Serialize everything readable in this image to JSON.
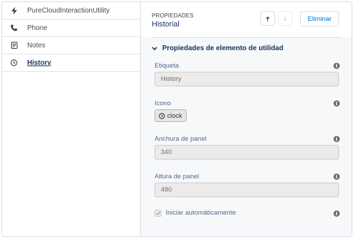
{
  "sidebar": {
    "items": [
      {
        "label": "PureCloudInteractionUtility",
        "icon": "lightning-icon"
      },
      {
        "label": "Phone",
        "icon": "phone-icon"
      },
      {
        "label": "Notes",
        "icon": "note-icon"
      },
      {
        "label": "History",
        "icon": "clock-icon",
        "active": true
      }
    ]
  },
  "header": {
    "eyebrow": "PROPIEDADES",
    "title": "Historial",
    "delete_label": "Eliminar"
  },
  "section": {
    "title": "Propiedades de elemento de utilidad"
  },
  "fields": {
    "label": {
      "label": "Etiqueta",
      "value": "History"
    },
    "icon": {
      "label": "Icono",
      "value": "clock"
    },
    "panel_width": {
      "label": "Anchura de panel",
      "value": "340"
    },
    "panel_height": {
      "label": "Altura de panel",
      "value": "480"
    },
    "autostart": {
      "label": "Iniciar automáticamente",
      "checked": true
    }
  },
  "colors": {
    "brand_link": "#0070d2",
    "title": "#16325c",
    "panel_bg": "#f7f8fa"
  }
}
